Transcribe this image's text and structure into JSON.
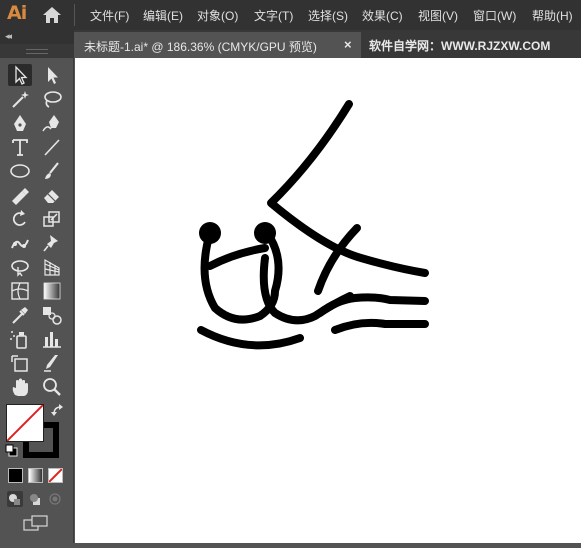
{
  "app": {
    "logo": "Ai"
  },
  "menu": [
    "文件(F)",
    "编辑(E)",
    "对象(O)",
    "文字(T)",
    "选择(S)",
    "效果(C)",
    "视图(V)",
    "窗口(W)",
    "帮助(H)"
  ],
  "document_tab": {
    "label": "未标题-1.ai* @ 186.36% (CMYK/GPU 预览)",
    "close": "×"
  },
  "watermark": "软件自学网：WWW.RJZXW.COM",
  "toolbar": {
    "collapse": "◂◂",
    "tools": [
      "selection-tool",
      "direct-selection-tool",
      "magic-wand-tool",
      "lasso-tool",
      "pen-tool",
      "curvature-tool",
      "type-tool",
      "line-segment-tool",
      "ellipse-tool",
      "paintbrush-tool",
      "shaper-tool",
      "eraser-tool",
      "rotate-tool",
      "scale-tool",
      "puppet-warp-tool",
      "pin-tool",
      "free-transform-tool",
      "perspective-grid-tool",
      "mesh-tool",
      "gradient-tool",
      "eyedropper-tool",
      "blend-tool",
      "symbol-sprayer-tool",
      "column-graph-tool",
      "artboard-tool",
      "slice-tool",
      "hand-tool",
      "zoom-tool"
    ],
    "active_tool": "selection-tool",
    "fill_color": "#ffffff",
    "stroke_color": "#000000"
  },
  "canvas": {
    "background": "#ffffff",
    "artwork_color": "#000000"
  }
}
